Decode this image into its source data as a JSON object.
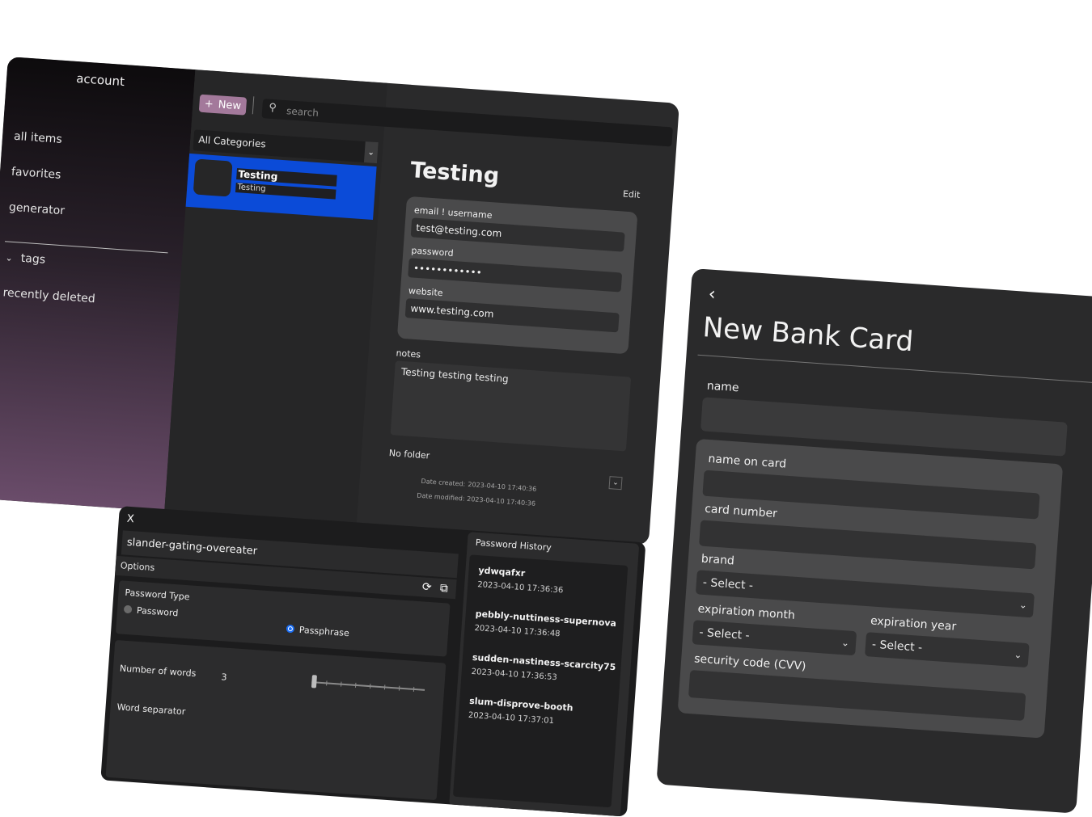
{
  "main": {
    "sidebar": {
      "account_label": "account",
      "items": [
        {
          "label": "all items"
        },
        {
          "label": "favorites"
        },
        {
          "label": "generator"
        },
        {
          "label": "tags"
        },
        {
          "label": "recently deleted"
        }
      ]
    },
    "toolbar": {
      "new_label": "New",
      "new_icon": "plus-icon",
      "search_placeholder": "search",
      "search_icon": "search-icon"
    },
    "category_select": "All Categories",
    "list": [
      {
        "title": "Testing",
        "subtitle": "Testing",
        "selected": true
      }
    ],
    "detail": {
      "title": "Testing",
      "edit_label": "Edit",
      "fields": [
        {
          "label": "email ! username",
          "value": "test@testing.com"
        },
        {
          "label": "password",
          "value": "••••••••••••"
        },
        {
          "label": "website",
          "value": "www.testing.com"
        }
      ],
      "notes_label": "notes",
      "notes_value": "Testing testing testing",
      "folder_value": "No folder",
      "date_created_label": "Date created:",
      "date_created": "2023-04-10 17:40:36",
      "date_modified_label": "Date modified:",
      "date_modified": "2023-04-10 17:40:36"
    },
    "colors": {
      "accent": "#a3799b",
      "selection": "#0b4bd8"
    }
  },
  "bank_card": {
    "title": "New Bank Card",
    "back_icon": "chevron-left-icon",
    "name_label": "name",
    "name_on_card_label": "name on card",
    "card_number_label": "card number",
    "brand_label": "brand",
    "brand_value": "- Select -",
    "expiration_month_label": "expiration month",
    "expiration_month_value": "- Select -",
    "expiration_year_label": "expiration year",
    "expiration_year_value": "- Select -",
    "security_code_label": "security code (CVV)"
  },
  "generator": {
    "close_label": "X",
    "output": "slander-gating-overeater",
    "options_label": "Options",
    "refresh_icon": "refresh-icon",
    "copy_icon": "copy-icon",
    "password_type_label": "Password Type",
    "type_options": [
      {
        "label": "Password",
        "selected": false
      },
      {
        "label": "Passphrase",
        "selected": true
      }
    ],
    "number_of_words_label": "Number of words",
    "number_of_words": "3",
    "word_separator_label": "Word separator",
    "history_title": "Password History",
    "history": [
      {
        "password": "ydwqafxr",
        "time": "2023-04-10 17:36:36"
      },
      {
        "password": "pebbly-nuttiness-supernova",
        "time": "2023-04-10 17:36:48"
      },
      {
        "password": "sudden-nastiness-scarcity75",
        "time": "2023-04-10 17:36:53"
      },
      {
        "password": "slum-disprove-booth",
        "time": "2023-04-10 17:37:01"
      }
    ]
  }
}
